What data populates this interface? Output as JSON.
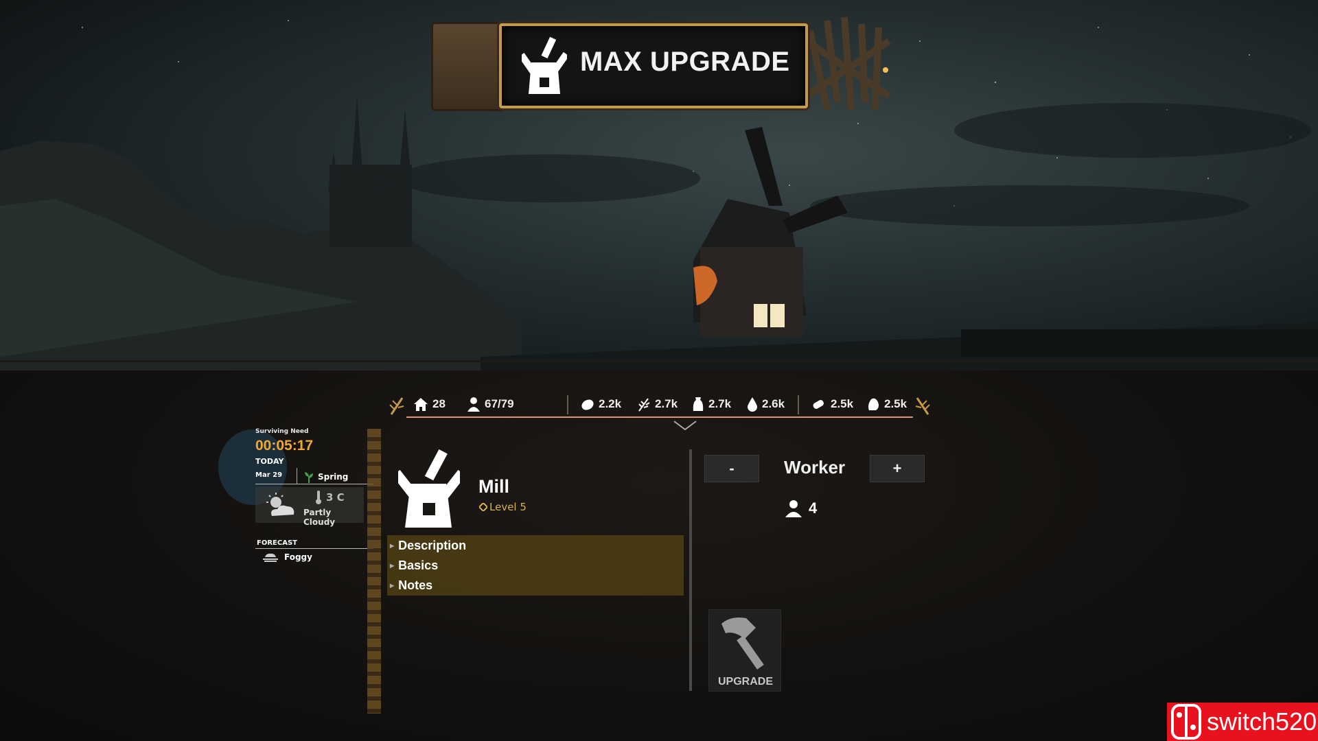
{
  "banner": {
    "title": "MAX UPGRADE",
    "icon": "windmill-icon"
  },
  "resources": {
    "houses": "28",
    "population": "67/79",
    "bread": "2.2k",
    "wheat": "2.7k",
    "flour": "2.7k",
    "water": "2.6k",
    "wood": "2.5k",
    "stone": "2.5k"
  },
  "status": {
    "surviving_need_label": "Surviving Need",
    "timer": "00:05:17",
    "today_label": "TODAY",
    "date": "Mar 29",
    "season": "Spring",
    "temperature": "3 C",
    "condition": "Partly Cloudy",
    "forecast_label": "FORECAST",
    "forecast": "Foggy"
  },
  "building": {
    "name": "Mill",
    "level": "Level 5",
    "sections": [
      "Description",
      "Basics",
      "Notes"
    ]
  },
  "workers": {
    "minus": "-",
    "label": "Worker",
    "plus": "+",
    "count": "4"
  },
  "upgrade": {
    "label": "UPGRADE"
  },
  "watermark": {
    "text": "switch520"
  },
  "colors": {
    "accent": "#f0a830",
    "bar_line": "#d99b5a",
    "level": "#d7b34a",
    "watermark": "#e8121f"
  }
}
